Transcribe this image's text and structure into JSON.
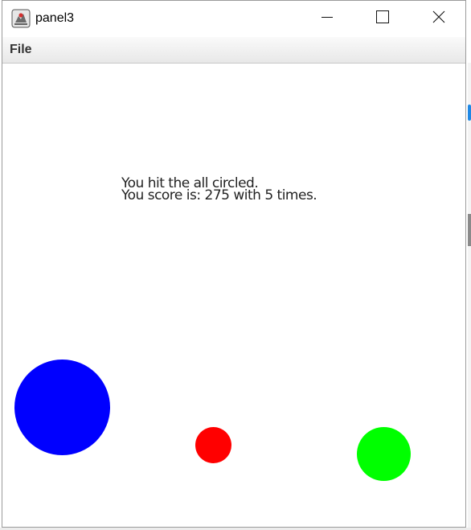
{
  "window": {
    "title": "panel3",
    "icon": "java-app-icon",
    "controls": [
      "minimize-icon",
      "maximize-icon",
      "close-icon"
    ]
  },
  "menubar": {
    "items": [
      {
        "label": "File"
      }
    ]
  },
  "canvas": {
    "message_line1": "You hit the all circled.",
    "message_line2": "You score is: 275 with 5 times.",
    "circles": [
      {
        "name": "blue-circle",
        "color": "#0000ff"
      },
      {
        "name": "red-circle",
        "color": "#ff0000"
      },
      {
        "name": "green-circle",
        "color": "#00ff00"
      }
    ]
  }
}
